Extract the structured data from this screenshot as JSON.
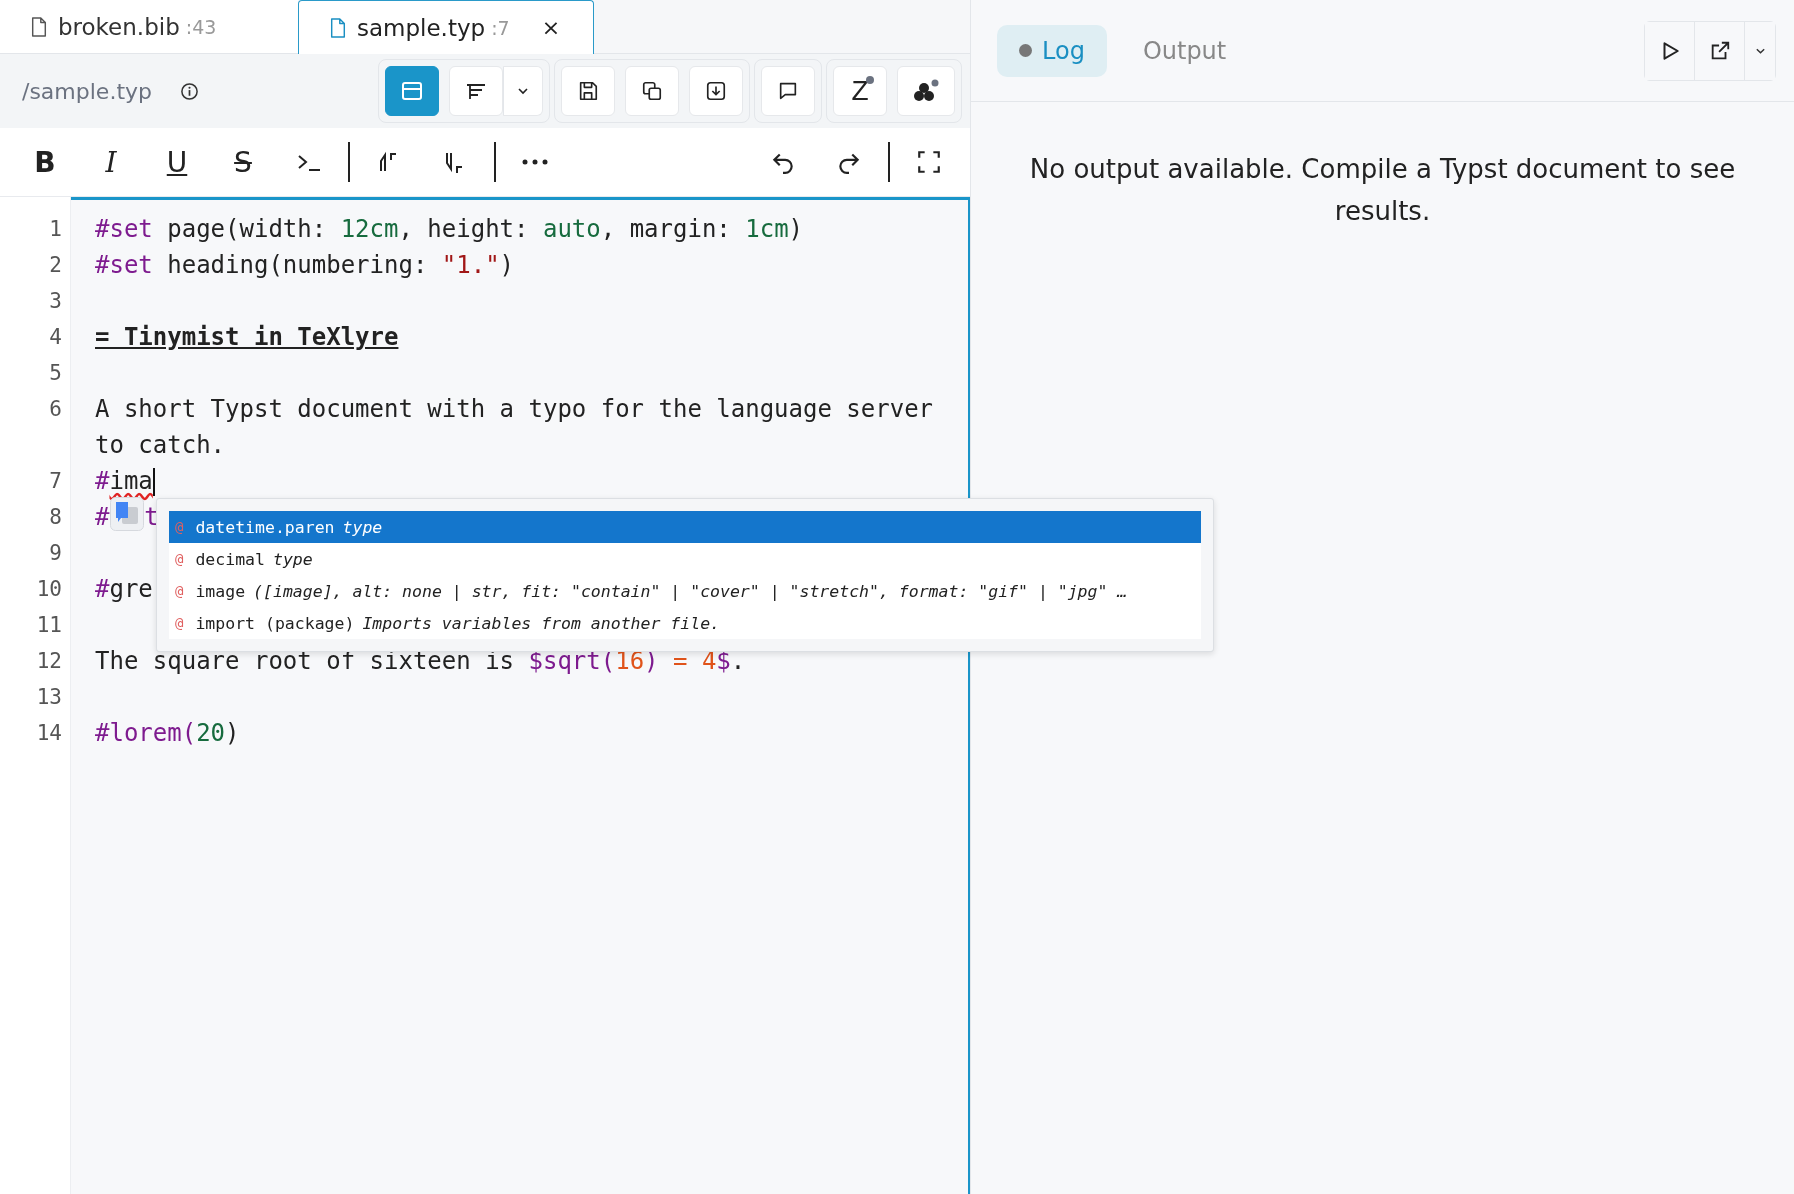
{
  "tabs": [
    {
      "name": "broken.bib",
      "line": ":43",
      "selected": false
    },
    {
      "name": "sample.typ",
      "line": ":7",
      "selected": true,
      "close": "×"
    }
  ],
  "path": "/sample.typ",
  "toolbar_groups": [
    [
      {
        "kind": "panel",
        "selected": true
      },
      {
        "kind": "wrap",
        "selected": false
      },
      {
        "kind": "caret",
        "selected": false
      }
    ],
    [
      {
        "kind": "save",
        "selected": false
      },
      {
        "kind": "copy",
        "selected": false
      },
      {
        "kind": "download",
        "selected": false
      }
    ],
    [
      {
        "kind": "comment",
        "selected": false
      }
    ],
    [
      {
        "kind": "letter",
        "label": "Z",
        "selected": false
      },
      {
        "kind": "nodes",
        "selected": false
      }
    ]
  ],
  "format_toolbar": {
    "left": [
      {
        "kind": "bold",
        "label": "B"
      },
      {
        "kind": "italic",
        "label": "I"
      },
      {
        "kind": "underline",
        "label": "U"
      },
      {
        "kind": "strike",
        "label": "S"
      },
      {
        "kind": "terminal"
      },
      {
        "kind": "separator"
      },
      {
        "kind": "superscript"
      },
      {
        "kind": "subscript"
      },
      {
        "kind": "separator"
      },
      {
        "kind": "more"
      }
    ],
    "right": [
      {
        "kind": "undo"
      },
      {
        "kind": "redo"
      },
      {
        "kind": "separator"
      },
      {
        "kind": "fullscreen"
      }
    ]
  },
  "editor": {
    "lines": [
      {
        "number": "1",
        "cursor": false,
        "tokens": [
          {
            "text": "#set",
            "kind": "keyword"
          },
          {
            "text": " page(width: ",
            "kind": "plain"
          },
          {
            "text": "12cm",
            "kind": "number"
          },
          {
            "text": ", height: ",
            "kind": "plain"
          },
          {
            "text": "auto",
            "kind": "number"
          },
          {
            "text": ", margin: ",
            "kind": "plain"
          },
          {
            "text": "1cm",
            "kind": "number"
          },
          {
            "text": ")",
            "kind": "plain"
          }
        ]
      },
      {
        "number": "2",
        "cursor": false,
        "tokens": [
          {
            "text": "#set",
            "kind": "keyword"
          },
          {
            "text": " heading(numbering: ",
            "kind": "plain"
          },
          {
            "text": "\"1.\"",
            "kind": "string"
          },
          {
            "text": ")",
            "kind": "plain"
          }
        ]
      },
      {
        "number": "3",
        "cursor": false
      },
      {
        "number": "4",
        "cursor": false,
        "tokens": [
          {
            "text": "= Tinymist in TeXlyre",
            "kind": "heading"
          }
        ]
      },
      {
        "number": "5",
        "cursor": false
      },
      {
        "number": "6",
        "cursor": false,
        "tokens": [
          {
            "text": "A short Typst document with a typo for the language server to catch.",
            "kind": "plain"
          }
        ]
      },
      {
        "number": "7",
        "cursor": true,
        "tokens": [
          {
            "text": "#",
            "kind": "keyword"
          },
          {
            "text": "ima",
            "kind": "error"
          }
        ]
      },
      {
        "number": "8",
        "cursor": false,
        "tokens": [
          {
            "text": "#",
            "kind": "keyword"
          },
          {
            "text": "t",
            "kind": "keyword",
            "after_gap": true
          }
        ]
      },
      {
        "number": "9",
        "cursor": false
      },
      {
        "number": "10",
        "cursor": false,
        "tokens": [
          {
            "text": "#",
            "kind": "keyword"
          },
          {
            "text": "gre",
            "kind": "plain"
          }
        ]
      },
      {
        "number": "11",
        "cursor": false
      },
      {
        "number": "12",
        "cursor": false,
        "tokens": [
          {
            "text": "The square root of sixteen is ",
            "kind": "plain"
          },
          {
            "text": "$sqrt(",
            "kind": "keyword"
          },
          {
            "text": "16",
            "kind": "mathnum"
          },
          {
            "text": ") ",
            "kind": "keyword"
          },
          {
            "text": "= 4",
            "kind": "mathnum"
          },
          {
            "text": "$",
            "kind": "keyword"
          },
          {
            "text": ".",
            "kind": "plain"
          }
        ]
      },
      {
        "number": "13",
        "cursor": false
      },
      {
        "number": "14",
        "cursor": false,
        "tokens": [
          {
            "text": "#lorem(",
            "kind": "keyword"
          },
          {
            "text": "20",
            "kind": "number"
          },
          {
            "text": ")",
            "kind": "plain"
          }
        ]
      }
    ]
  },
  "completion": [
    {
      "symbol": "@",
      "label": "datetime.paren",
      "detail": "type",
      "selected": true
    },
    {
      "symbol": "@",
      "label": "decimal",
      "detail": "type",
      "selected": false
    },
    {
      "symbol": "@",
      "label": "image",
      "detail": "([image], alt: none | str, fit: \"contain\" | \"cover\" | \"stretch\", format: \"gif\" | \"jpg\" …",
      "selected": false
    },
    {
      "symbol": "@",
      "label": "import (package)",
      "detail": "Imports variables from another file.",
      "selected": false
    }
  ],
  "output_panel": {
    "tabs": [
      {
        "label": "Log",
        "selected": true,
        "dot": true
      },
      {
        "label": "Output",
        "selected": false,
        "dot": false
      }
    ],
    "message": "No output available. Compile a Typst document to see results."
  }
}
